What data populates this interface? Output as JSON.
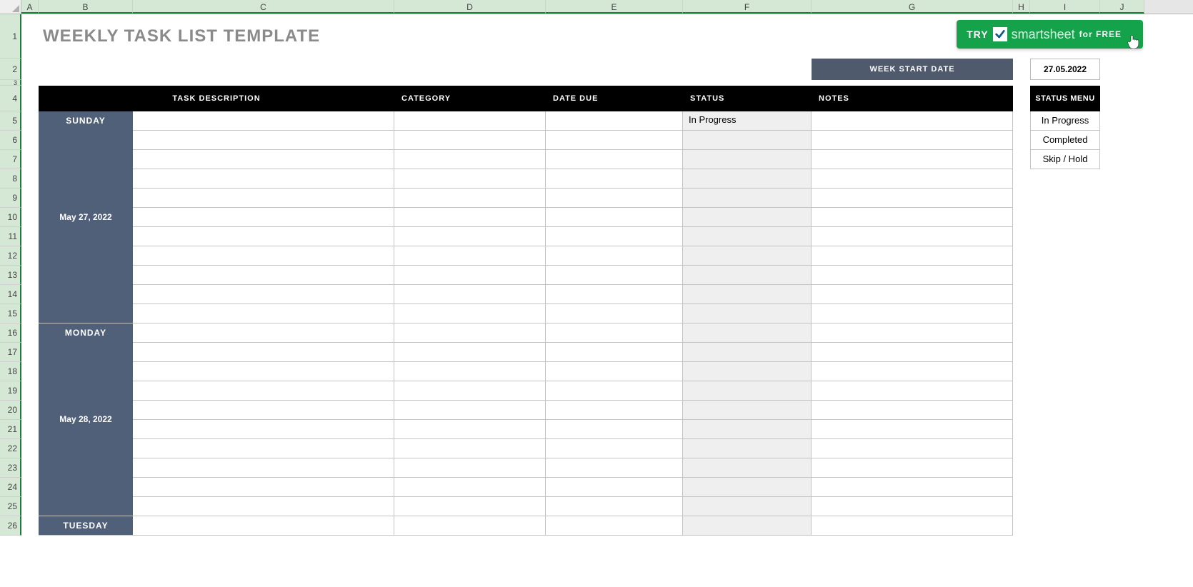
{
  "columns": [
    "A",
    "B",
    "C",
    "D",
    "E",
    "F",
    "G",
    "H",
    "I",
    "J"
  ],
  "title": "WEEKLY TASK LIST TEMPLATE",
  "smartsheet": {
    "try": "TRY",
    "brand": "smartsheet",
    "forfree": "for FREE"
  },
  "week_start": {
    "label": "WEEK START DATE",
    "date": "27.05.2022"
  },
  "headers": {
    "task_desc": "TASK DESCRIPTION",
    "category": "CATEGORY",
    "date_due": "DATE DUE",
    "status": "STATUS",
    "notes": "NOTES",
    "status_menu": "STATUS MENU"
  },
  "days": [
    {
      "name": "SUNDAY",
      "date": "May 27, 2022",
      "rows": [
        {
          "desc": "",
          "category": "",
          "due": "",
          "status": "In Progress",
          "notes": ""
        },
        {
          "desc": "",
          "category": "",
          "due": "",
          "status": "",
          "notes": ""
        },
        {
          "desc": "",
          "category": "",
          "due": "",
          "status": "",
          "notes": ""
        },
        {
          "desc": "",
          "category": "",
          "due": "",
          "status": "",
          "notes": ""
        },
        {
          "desc": "",
          "category": "",
          "due": "",
          "status": "",
          "notes": ""
        },
        {
          "desc": "",
          "category": "",
          "due": "",
          "status": "",
          "notes": ""
        },
        {
          "desc": "",
          "category": "",
          "due": "",
          "status": "",
          "notes": ""
        },
        {
          "desc": "",
          "category": "",
          "due": "",
          "status": "",
          "notes": ""
        },
        {
          "desc": "",
          "category": "",
          "due": "",
          "status": "",
          "notes": ""
        },
        {
          "desc": "",
          "category": "",
          "due": "",
          "status": "",
          "notes": ""
        },
        {
          "desc": "",
          "category": "",
          "due": "",
          "status": "",
          "notes": ""
        }
      ]
    },
    {
      "name": "MONDAY",
      "date": "May 28, 2022",
      "rows": [
        {
          "desc": "",
          "category": "",
          "due": "",
          "status": "",
          "notes": ""
        },
        {
          "desc": "",
          "category": "",
          "due": "",
          "status": "",
          "notes": ""
        },
        {
          "desc": "",
          "category": "",
          "due": "",
          "status": "",
          "notes": ""
        },
        {
          "desc": "",
          "category": "",
          "due": "",
          "status": "",
          "notes": ""
        },
        {
          "desc": "",
          "category": "",
          "due": "",
          "status": "",
          "notes": ""
        },
        {
          "desc": "",
          "category": "",
          "due": "",
          "status": "",
          "notes": ""
        },
        {
          "desc": "",
          "category": "",
          "due": "",
          "status": "",
          "notes": ""
        },
        {
          "desc": "",
          "category": "",
          "due": "",
          "status": "",
          "notes": ""
        },
        {
          "desc": "",
          "category": "",
          "due": "",
          "status": "",
          "notes": ""
        },
        {
          "desc": "",
          "category": "",
          "due": "",
          "status": "",
          "notes": ""
        }
      ]
    },
    {
      "name": "TUESDAY",
      "date": "",
      "rows": []
    }
  ],
  "status_menu_items": [
    "In Progress",
    "Completed",
    "Skip / Hold"
  ],
  "row_numbers_r3_offset": 0
}
